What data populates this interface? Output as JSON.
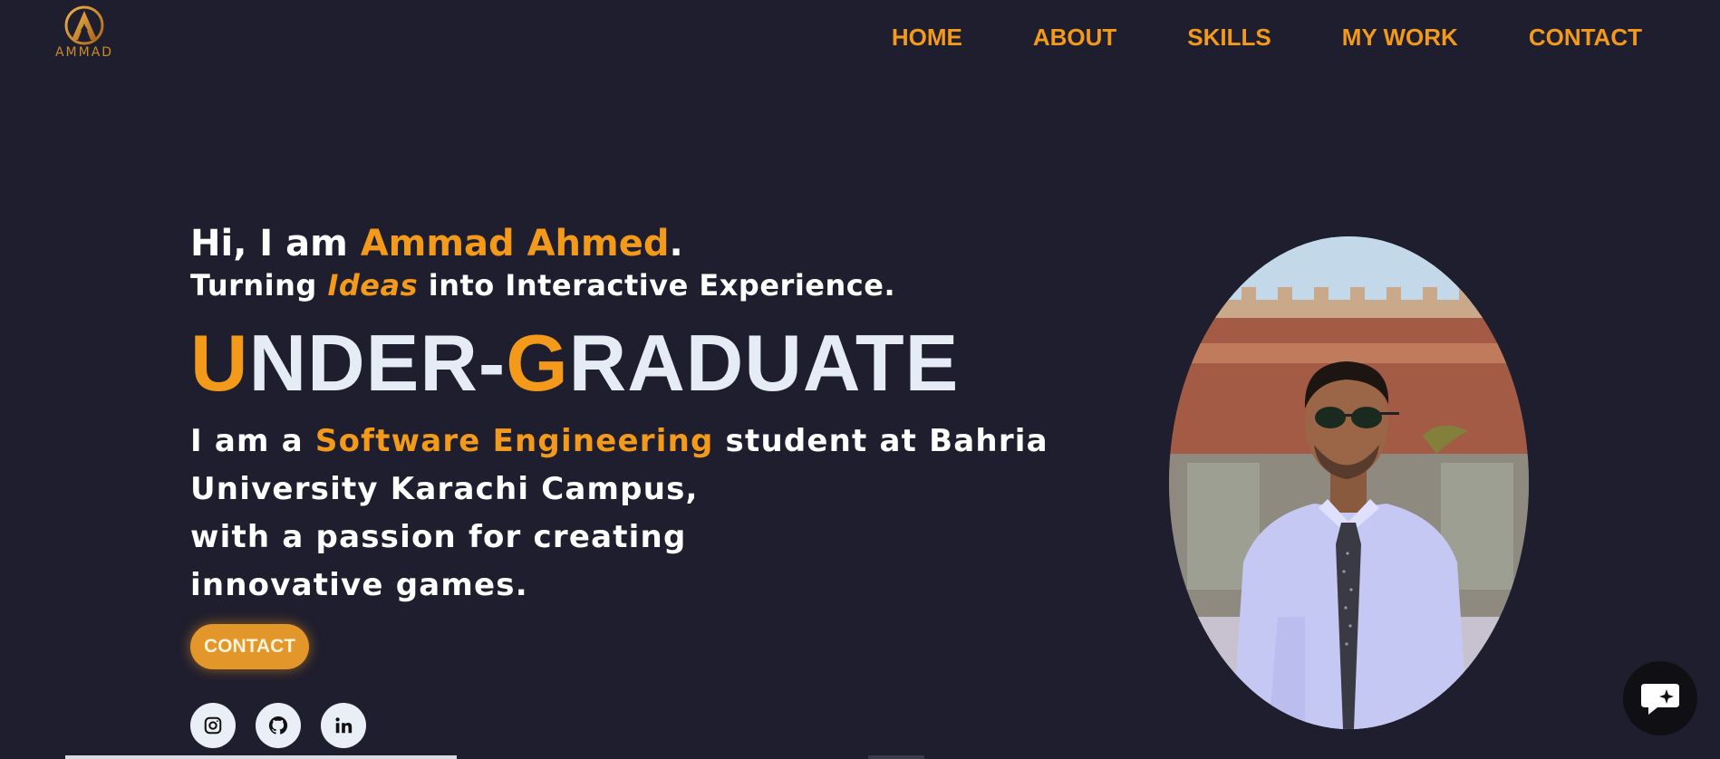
{
  "brand": {
    "logo_text": "AMMAD",
    "accent_color": "#f39a1a",
    "bg_color": "#1f1e2e"
  },
  "nav": {
    "items": [
      {
        "label": "HOME"
      },
      {
        "label": "ABOUT"
      },
      {
        "label": "SKILLS"
      },
      {
        "label": "MY WORK"
      },
      {
        "label": "CONTACT"
      }
    ]
  },
  "hero": {
    "greet_prefix": "Hi, I am ",
    "name": "Ammad Ahmed",
    "greet_suffix": ".",
    "tagline_prefix": "Turning ",
    "tagline_accent": "Ideas",
    "tagline_suffix": " into Interactive Experience.",
    "title_first_a": "U",
    "title_rest_a": "NDER-",
    "title_first_b": "G",
    "title_rest_b": "RADUATE",
    "desc_line1_prefix": "I am a ",
    "desc_line1_accent": "Software Engineering",
    "desc_line1_suffix": " student at Bahria",
    "desc_line2": "University Karachi Campus,",
    "desc_line3": "with a passion for creating",
    "desc_line4": "innovative games.",
    "contact_button": "CONTACT"
  },
  "socials": [
    {
      "icon": "instagram-icon"
    },
    {
      "icon": "github-icon"
    },
    {
      "icon": "linkedin-icon"
    }
  ],
  "chat": {
    "icon": "chat-sparkle-icon"
  }
}
